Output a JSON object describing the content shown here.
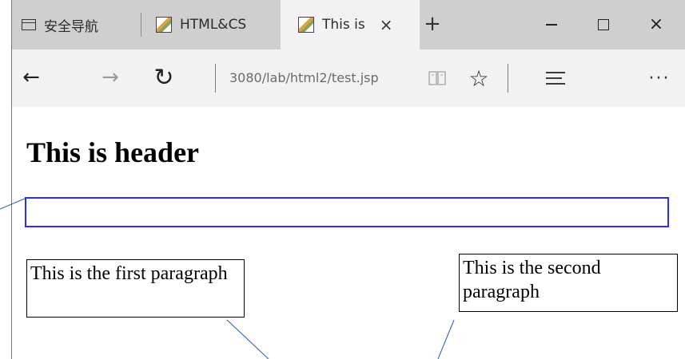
{
  "tabs": [
    {
      "label": "安全导航",
      "icon": "page-icon"
    },
    {
      "label": "HTML&CS",
      "icon": "image-favicon-icon"
    },
    {
      "label": "This is",
      "icon": "image-favicon-icon",
      "active": true,
      "close": "×"
    }
  ],
  "newtab": "+",
  "window_buttons": {
    "close": "×"
  },
  "nav": {
    "back": "←",
    "forward": "→",
    "refresh": "↻",
    "url": "3080/lab/html2/test.jsp",
    "favorite": "☆",
    "more": "···"
  },
  "page": {
    "header": "This is header",
    "input_value": "",
    "paragraph1": "This is the first paragraph",
    "paragraph2": "This is the second paragraph"
  },
  "colors": {
    "input_border": "#2b2bff",
    "tabbar": "#cfcfcf",
    "toolbar": "#f2f2f2"
  }
}
